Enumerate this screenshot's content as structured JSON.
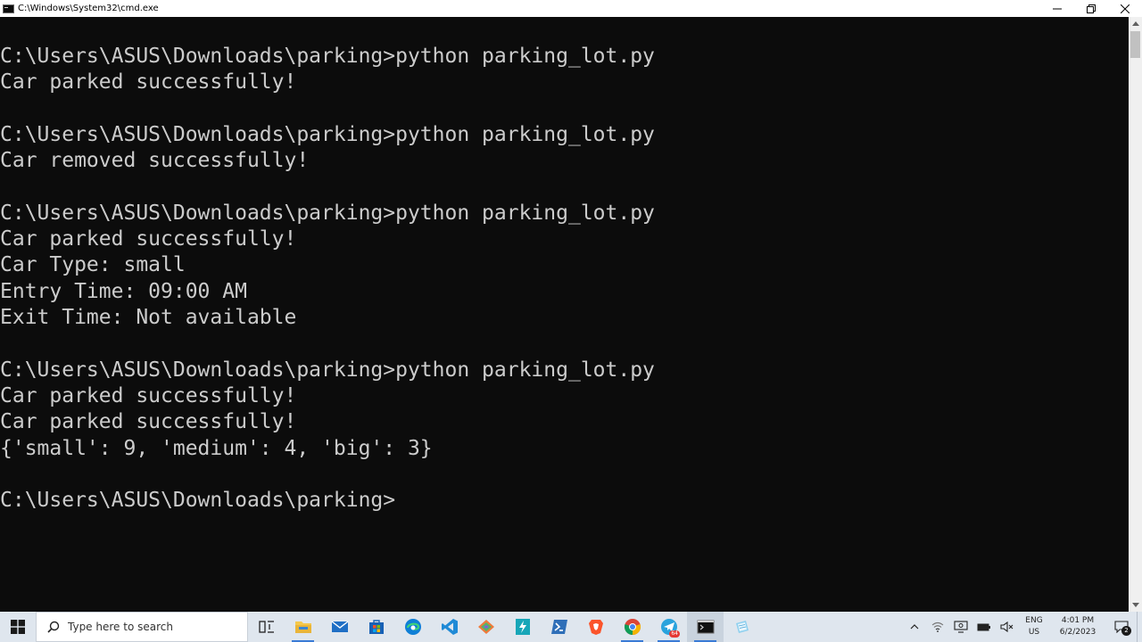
{
  "window": {
    "title": "C:\\Windows\\System32\\cmd.exe"
  },
  "console": {
    "lines": [
      "C:\\Users\\ASUS\\Downloads\\parking>python parking_lot.py",
      "Car parked successfully!",
      "",
      "C:\\Users\\ASUS\\Downloads\\parking>python parking_lot.py",
      "Car removed successfully!",
      "",
      "C:\\Users\\ASUS\\Downloads\\parking>python parking_lot.py",
      "Car parked successfully!",
      "Car Type: small",
      "Entry Time: 09:00 AM",
      "Exit Time: Not available",
      "",
      "C:\\Users\\ASUS\\Downloads\\parking>python parking_lot.py",
      "Car parked successfully!",
      "Car parked successfully!",
      "{'small': 9, 'medium': 4, 'big': 3}",
      "",
      "C:\\Users\\ASUS\\Downloads\\parking>"
    ],
    "text_color": "#cccccc",
    "background": "#0c0c0c"
  },
  "taskbar": {
    "search_placeholder": "Type here to search",
    "apps": [
      {
        "name": "task-view-icon"
      },
      {
        "name": "file-explorer-icon"
      },
      {
        "name": "mail-icon"
      },
      {
        "name": "microsoft-store-icon"
      },
      {
        "name": "edge-icon"
      },
      {
        "name": "vscode-icon"
      },
      {
        "name": "git-kraken-icon"
      },
      {
        "name": "power-automate-icon"
      },
      {
        "name": "powershell-icon"
      },
      {
        "name": "brave-icon"
      },
      {
        "name": "chrome-icon"
      },
      {
        "name": "telegram-icon"
      },
      {
        "name": "cmd-icon"
      },
      {
        "name": "notepad-icon"
      }
    ],
    "telegram_badge": "64",
    "language_top": "ENG",
    "language_bottom": "US",
    "time": "4:01 PM",
    "date": "6/2/2023",
    "notification_count": "2"
  }
}
